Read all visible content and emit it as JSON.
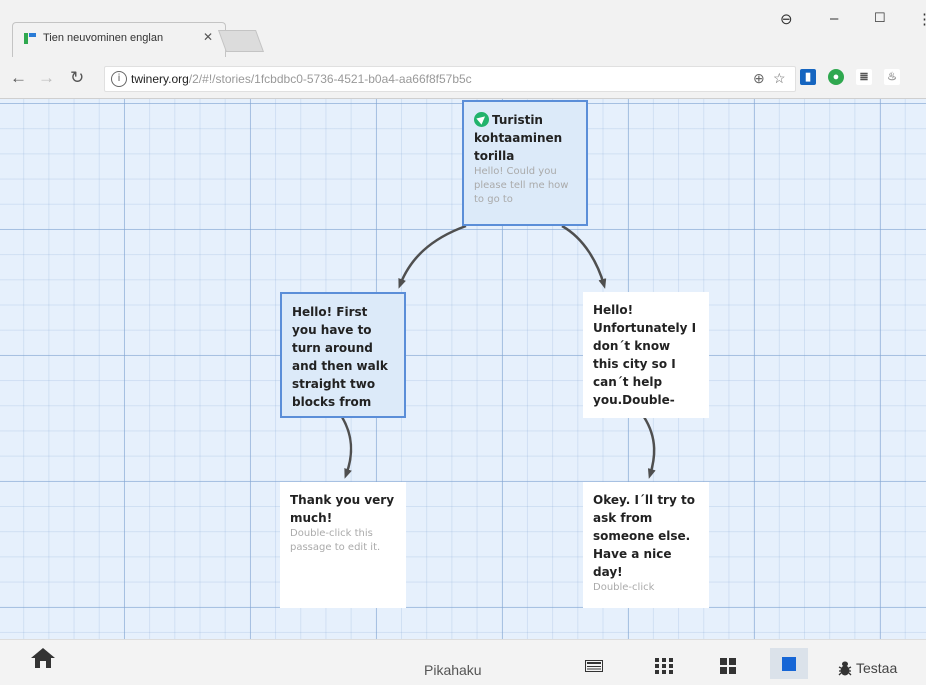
{
  "browser": {
    "tab_title": "Tien neuvominen englan",
    "url_host": "twinery.org",
    "url_path": "/2/#!/stories/1fcbdbc0-5736-4521-b0a4-aa66f8f57b5c",
    "colors": {
      "ext_blue": "#1565c0",
      "ext_green": "#2fa84f"
    }
  },
  "passages": [
    {
      "title": "Turistin kohtaaminen torilla",
      "excerpt": "Hello! Could you please tell me how to go to",
      "start": true,
      "selected": true
    },
    {
      "title": "Hello! First you have to turn around and then walk straight two blocks from",
      "excerpt": "",
      "start": false,
      "selected": true
    },
    {
      "title": "Hello! Unfortunately I don´t know this city so I can´t help you.Double-",
      "excerpt": "",
      "start": false,
      "selected": false
    },
    {
      "title": "Thank you very much!",
      "excerpt": "Double-click this passage to edit it.",
      "start": false,
      "selected": false
    },
    {
      "title": "Okey. I´ll try to ask from someone else. Have a nice day!",
      "excerpt": "Double-click",
      "start": false,
      "selected": false
    }
  ],
  "bottom": {
    "quick_find": "Pikahaku",
    "test_label": "Testaa",
    "active_zoom": "zoom-100"
  },
  "colors": {
    "grid_bg": "#e6f0fc",
    "selected_border": "#5b8ed8",
    "start_green": "#22b36c",
    "arrow": "#4f4f4f"
  }
}
